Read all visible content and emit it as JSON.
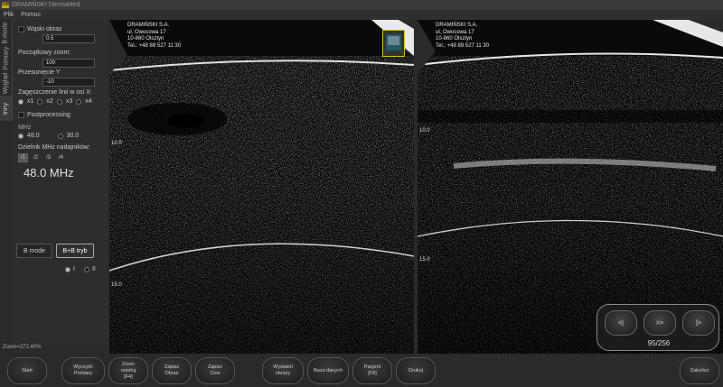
{
  "window": {
    "title": "DRAMIŃSKI DermaMed",
    "logo_text": "DM"
  },
  "menu": [
    "Plik",
    "Pomoc"
  ],
  "side_tabs": [
    "B mode",
    "Pomiary",
    "Wygląd",
    "Inny"
  ],
  "panel": {
    "narrow_label": "Wąski obraz",
    "narrow_value": "0.5",
    "zoom_label": "Początkowy zoom:",
    "zoom_value": "100",
    "shift_label": "Przesunięcie Y",
    "shift_value": "-10",
    "density_label": "Zagęszczenie linii w osi X:",
    "density_options": [
      "x1",
      "x2",
      "x3",
      "x4"
    ],
    "postprocessing_label": "Postprocessing",
    "mhz_label": "MHz",
    "mhz_options": [
      "48.0",
      "30.0"
    ],
    "divider_label": "Dzielnik MHz nadajników:",
    "divider_options": [
      "/1",
      "/2",
      "/3",
      "/4"
    ],
    "frequency": "48.0 MHz",
    "bmode_button": "B mode",
    "bb_button": "B+B tryb",
    "toggle_labels": [
      "I",
      "II"
    ]
  },
  "zoom_status": "Zoom=272.40%",
  "image_left": {
    "address": [
      "DRAMIŃSKI S.A.",
      "ul. Owocowa 17",
      "10-860 Olsztyn",
      "Tel.: +48 89 527 11 30"
    ],
    "depth_labels": [
      "10.0",
      "15.0"
    ]
  },
  "image_right": {
    "address": [
      "DRAMIŃSKI S.A.",
      "ul. Owocowa 17",
      "10-860 Olsztyn",
      "Tel.: +48 89 527 11 30"
    ],
    "depth_labels": [
      "10.0",
      "15.0"
    ]
  },
  "navigator": {
    "prev": "<|",
    "play": ">>",
    "next": "|>",
    "counter": "95/256"
  },
  "bottom_buttons": {
    "start": "Start",
    "clear": "Wyczyść\nPomiary",
    "zoom_reset": "Zoom\nresetuj\n[F4]",
    "save_image": "Zapisz\nObraz",
    "save_cine": "Zapisz\nCine",
    "show_images": "Wyświetl\nobrazy",
    "database": "Baza danych",
    "patient": "Pacjent\n[F8]",
    "print": "Drukuj",
    "exit": "Zakończ"
  }
}
